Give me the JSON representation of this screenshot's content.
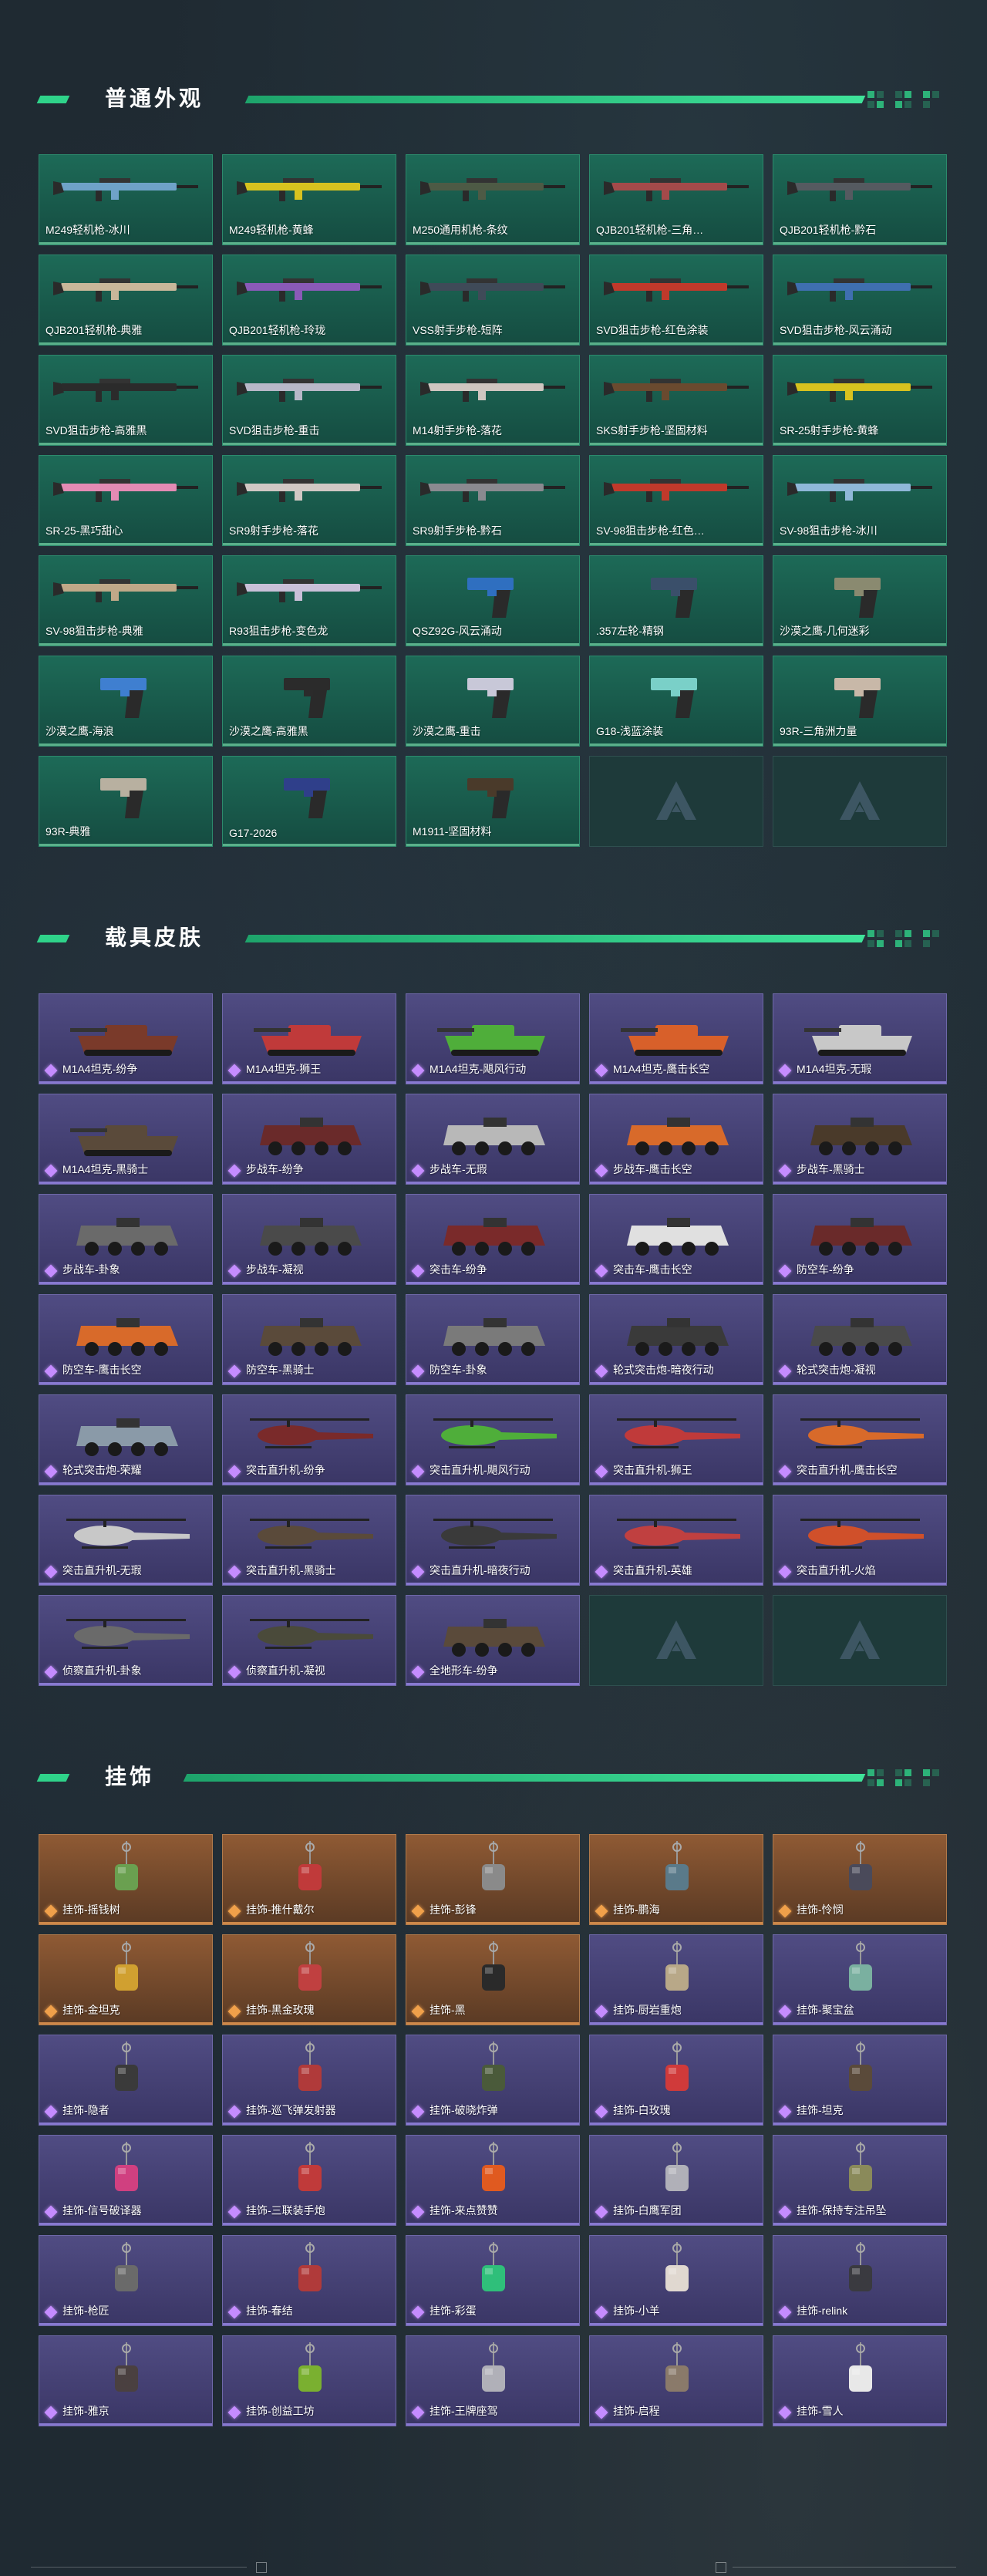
{
  "sections": [
    {
      "title": "普通外观",
      "theme": "green",
      "items": [
        {
          "label": "M249轻机枪-冰川",
          "kind": "rifle",
          "color": "#6fa2c8"
        },
        {
          "label": "M249轻机枪-黄蜂",
          "kind": "rifle",
          "color": "#d7c21f"
        },
        {
          "label": "M250通用机枪-条纹",
          "kind": "rifle",
          "color": "#4d5a45"
        },
        {
          "label": "QJB201轻机枪-三角…",
          "kind": "rifle",
          "color": "#a44a4a"
        },
        {
          "label": "QJB201轻机枪-黔石",
          "kind": "rifle",
          "color": "#555a60"
        },
        {
          "label": "QJB201轻机枪-典雅",
          "kind": "rifle",
          "color": "#c9b79a"
        },
        {
          "label": "QJB201轻机枪-玲珑",
          "kind": "rifle",
          "color": "#8a5ab8"
        },
        {
          "label": "VSS射手步枪-短阵",
          "kind": "rifle",
          "color": "#3f4a58"
        },
        {
          "label": "SVD狙击步枪-红色涂装",
          "kind": "rifle",
          "color": "#c0392b"
        },
        {
          "label": "SVD狙击步枪-风云涌动",
          "kind": "rifle",
          "color": "#3f6fb0"
        },
        {
          "label": "SVD狙击步枪-高雅黑",
          "kind": "rifle",
          "color": "#2b2b2b"
        },
        {
          "label": "SVD狙击步枪-重击",
          "kind": "rifle",
          "color": "#b8b8c8"
        },
        {
          "label": "M14射手步枪-落花",
          "kind": "rifle",
          "color": "#cfc6c0"
        },
        {
          "label": "SKS射手步枪-坚固材料",
          "kind": "rifle",
          "color": "#6a4a2f"
        },
        {
          "label": "SR-25射手步枪-黄蜂",
          "kind": "rifle",
          "color": "#d7c21f"
        },
        {
          "label": "SR-25-黑巧甜心",
          "kind": "rifle",
          "color": "#e38bb4"
        },
        {
          "label": "SR9射手步枪-落花",
          "kind": "rifle",
          "color": "#d0c8c4"
        },
        {
          "label": "SR9射手步枪-黔石",
          "kind": "rifle",
          "color": "#8a8a90"
        },
        {
          "label": "SV-98狙击步枪-红色…",
          "kind": "rifle",
          "color": "#c0392b"
        },
        {
          "label": "SV-98狙击步枪-冰川",
          "kind": "rifle",
          "color": "#8fb8d8"
        },
        {
          "label": "SV-98狙击步枪-典雅",
          "kind": "rifle",
          "color": "#bfa888"
        },
        {
          "label": "R93狙击步枪-变色龙",
          "kind": "rifle",
          "color": "#c9c0d8"
        },
        {
          "label": "QSZ92G-风云涌动",
          "kind": "pistol",
          "color": "#2f6fc0"
        },
        {
          "label": ".357左轮-精钢",
          "kind": "pistol",
          "color": "#3a4f6a"
        },
        {
          "label": "沙漠之鹰-几何迷彩",
          "kind": "pistol",
          "color": "#8a8a70"
        },
        {
          "label": "沙漠之鹰-海浪",
          "kind": "pistol",
          "color": "#3f7fd0"
        },
        {
          "label": "沙漠之鹰-高雅黑",
          "kind": "pistol",
          "color": "#2b2b2b"
        },
        {
          "label": "沙漠之鹰-重击",
          "kind": "pistol",
          "color": "#c8c8d8"
        },
        {
          "label": "G18-浅蓝涂装",
          "kind": "pistol",
          "color": "#7ad0c8"
        },
        {
          "label": "93R-三角洲力量",
          "kind": "pistol",
          "color": "#c8b8a8"
        },
        {
          "label": "93R-典雅",
          "kind": "pistol",
          "color": "#b8b0a0"
        },
        {
          "label": "G17-2026",
          "kind": "pistol",
          "color": "#2f3f8a"
        },
        {
          "label": "M1911-坚固材料",
          "kind": "pistol",
          "color": "#4a3a2a"
        },
        {
          "label": "",
          "kind": "empty"
        },
        {
          "label": "",
          "kind": "empty"
        }
      ]
    },
    {
      "title": "载具皮肤",
      "theme": "purple",
      "items": [
        {
          "label": "M1A4坦克-纷争",
          "kind": "tank",
          "color": "#7a3a2a"
        },
        {
          "label": "M1A4坦克-狮王",
          "kind": "tank",
          "color": "#c03a3a"
        },
        {
          "label": "M1A4坦克-飓风行动",
          "kind": "tank",
          "color": "#4fae3a"
        },
        {
          "label": "M1A4坦克-鹰击长空",
          "kind": "tank",
          "color": "#d8602a"
        },
        {
          "label": "M1A4坦克-无瑕",
          "kind": "tank",
          "color": "#c8c8c8"
        },
        {
          "label": "M1A4坦克-黑骑士",
          "kind": "tank",
          "color": "#5a4a3a"
        },
        {
          "label": "步战车-纷争",
          "kind": "apc",
          "color": "#6a2a2a"
        },
        {
          "label": "步战车-无瑕",
          "kind": "apc",
          "color": "#b8b8b8"
        },
        {
          "label": "步战车-鹰击长空",
          "kind": "apc",
          "color": "#d86a2a"
        },
        {
          "label": "步战车-黑骑士",
          "kind": "apc",
          "color": "#4a3a2a"
        },
        {
          "label": "步战车-卦象",
          "kind": "apc",
          "color": "#6a6a6a"
        },
        {
          "label": "步战车-凝视",
          "kind": "apc",
          "color": "#4a4a4a"
        },
        {
          "label": "突击车-纷争",
          "kind": "apc",
          "color": "#7a2a2a"
        },
        {
          "label": "突击车-鹰击长空",
          "kind": "apc",
          "color": "#e0e0e0"
        },
        {
          "label": "防空车-纷争",
          "kind": "apc",
          "color": "#6a2a2a"
        },
        {
          "label": "防空车-鹰击长空",
          "kind": "apc",
          "color": "#d86a2a"
        },
        {
          "label": "防空车-黑骑士",
          "kind": "apc",
          "color": "#5a4a3a"
        },
        {
          "label": "防空车-卦象",
          "kind": "apc",
          "color": "#7a7a7a"
        },
        {
          "label": "轮式突击炮-暗夜行动",
          "kind": "apc",
          "color": "#3a3a3a"
        },
        {
          "label": "轮式突击炮-凝视",
          "kind": "apc",
          "color": "#4a4a4a"
        },
        {
          "label": "轮式突击炮-荣耀",
          "kind": "apc",
          "color": "#8a9aa8"
        },
        {
          "label": "突击直升机-纷争",
          "kind": "heli",
          "color": "#7a2a2a"
        },
        {
          "label": "突击直升机-飓风行动",
          "kind": "heli",
          "color": "#4fae3a"
        },
        {
          "label": "突击直升机-狮王",
          "kind": "heli",
          "color": "#c03a3a"
        },
        {
          "label": "突击直升机-鹰击长空",
          "kind": "heli",
          "color": "#d86a2a"
        },
        {
          "label": "突击直升机-无瑕",
          "kind": "heli",
          "color": "#c8c8c8"
        },
        {
          "label": "突击直升机-黑骑士",
          "kind": "heli",
          "color": "#5a4a3a"
        },
        {
          "label": "突击直升机-暗夜行动",
          "kind": "heli",
          "color": "#3a3a3a"
        },
        {
          "label": "突击直升机-英雄",
          "kind": "heli",
          "color": "#c04040"
        },
        {
          "label": "突击直升机-火焰",
          "kind": "heli",
          "color": "#d0502a"
        },
        {
          "label": "侦察直升机-卦象",
          "kind": "heli",
          "color": "#6a6a6a"
        },
        {
          "label": "侦察直升机-凝视",
          "kind": "heli",
          "color": "#4a4a3a"
        },
        {
          "label": "全地形车-纷争",
          "kind": "apc",
          "color": "#5a4a3a"
        },
        {
          "label": "",
          "kind": "empty"
        },
        {
          "label": "",
          "kind": "empty"
        }
      ]
    },
    {
      "title": "挂饰",
      "theme": "mixed",
      "items": [
        {
          "label": "挂饰-摇钱树",
          "kind": "charm",
          "rarity": "gold",
          "color": "#6aa050"
        },
        {
          "label": "挂饰-推什戴尔",
          "kind": "charm",
          "rarity": "gold",
          "color": "#c03a3a"
        },
        {
          "label": "挂饰-彭锋",
          "kind": "charm",
          "rarity": "gold",
          "color": "#8a8a8a"
        },
        {
          "label": "挂饰-鹏海",
          "kind": "charm",
          "rarity": "gold",
          "color": "#5a7a8a"
        },
        {
          "label": "挂饰-怜悯",
          "kind": "charm",
          "rarity": "gold",
          "color": "#4a4a5a"
        },
        {
          "label": "挂饰-金坦克",
          "kind": "charm",
          "rarity": "gold",
          "color": "#d0a030"
        },
        {
          "label": "挂饰-黑金玫瑰",
          "kind": "charm",
          "rarity": "gold",
          "color": "#c04040"
        },
        {
          "label": "挂饰-黑",
          "kind": "charm",
          "rarity": "gold",
          "color": "#2a2a2a"
        },
        {
          "label": "挂饰-厨岩重炮",
          "kind": "charm",
          "rarity": "purple",
          "color": "#b8a888"
        },
        {
          "label": "挂饰-聚宝盆",
          "kind": "charm",
          "rarity": "purple",
          "color": "#7ab0a0"
        },
        {
          "label": "挂饰-隐者",
          "kind": "charm",
          "rarity": "purple",
          "color": "#3a3a3a"
        },
        {
          "label": "挂饰-巡飞弹发射器",
          "kind": "charm",
          "rarity": "purple",
          "color": "#b03a3a"
        },
        {
          "label": "挂饰-破晓炸弹",
          "kind": "charm",
          "rarity": "purple",
          "color": "#4a5a3a"
        },
        {
          "label": "挂饰-白玫瑰",
          "kind": "charm",
          "rarity": "purple",
          "color": "#d03a3a"
        },
        {
          "label": "挂饰-坦克",
          "kind": "charm",
          "rarity": "purple",
          "color": "#5a4a3a"
        },
        {
          "label": "挂饰-信号破译器",
          "kind": "charm",
          "rarity": "purple",
          "color": "#d04080"
        },
        {
          "label": "挂饰-三联装手炮",
          "kind": "charm",
          "rarity": "purple",
          "color": "#c03a3a"
        },
        {
          "label": "挂饰-来点赞赞",
          "kind": "charm",
          "rarity": "purple",
          "color": "#e05a20"
        },
        {
          "label": "挂饰-白鹰军团",
          "kind": "charm",
          "rarity": "purple",
          "color": "#b0b0b8"
        },
        {
          "label": "挂饰-保持专注吊坠",
          "kind": "charm",
          "rarity": "purple",
          "color": "#8a8a5a"
        },
        {
          "label": "挂饰-枪匠",
          "kind": "charm",
          "rarity": "purple",
          "color": "#6a6a6a"
        },
        {
          "label": "挂饰-春结",
          "kind": "charm",
          "rarity": "purple",
          "color": "#b03a3a"
        },
        {
          "label": "挂饰-彩蛋",
          "kind": "charm",
          "rarity": "purple",
          "color": "#2fbf7a"
        },
        {
          "label": "挂饰-小羊",
          "kind": "charm",
          "rarity": "purple",
          "color": "#e0d8d0"
        },
        {
          "label": "挂饰-relink",
          "kind": "charm",
          "rarity": "purple",
          "color": "#3a3a40"
        },
        {
          "label": "挂饰-雅京",
          "kind": "charm",
          "rarity": "purple",
          "color": "#4a4040"
        },
        {
          "label": "挂饰-创益工坊",
          "kind": "charm",
          "rarity": "purple",
          "color": "#7ab030"
        },
        {
          "label": "挂饰-王牌座驾",
          "kind": "charm",
          "rarity": "purple",
          "color": "#b0b0b8"
        },
        {
          "label": "挂饰-启程",
          "kind": "charm",
          "rarity": "purple",
          "color": "#8a7a6a"
        },
        {
          "label": "挂饰-雪人",
          "kind": "charm",
          "rarity": "purple",
          "color": "#e8e8e8"
        }
      ]
    }
  ]
}
